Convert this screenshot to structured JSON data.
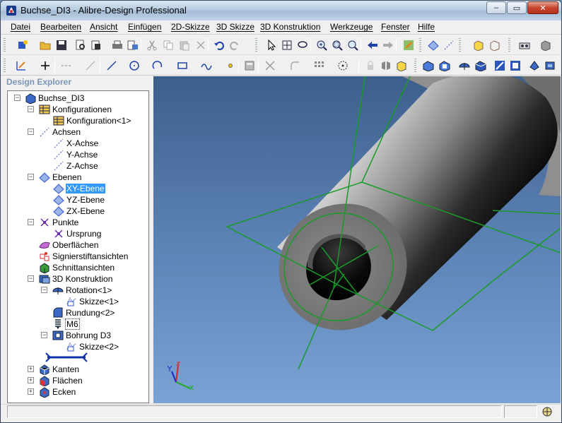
{
  "window": {
    "title": "Buchse_DI3 - Alibre-Design Professional",
    "minimize": "‒",
    "maximize": "▭",
    "close": "✕"
  },
  "menu": [
    "Datei",
    "Bearbeiten",
    "Ansicht",
    "Einfügen",
    "2D-Skizze",
    "3D Skizze",
    "3D Konstruktion",
    "Werkzeuge",
    "Fenster",
    "Hilfe"
  ],
  "explorer": {
    "header": "Design Explorer",
    "root": "Buchse_DI3",
    "konfigurationen": "Konfigurationen",
    "konfiguration1": "Konfiguration<1>",
    "achsen": "Achsen",
    "x_achse": "X-Achse",
    "y_achse": "Y-Achse",
    "z_achse": "Z-Achse",
    "ebenen": "Ebenen",
    "xy_ebene": "XY-Ebene",
    "yz_ebene": "YZ-Ebene",
    "zx_ebene": "ZX-Ebene",
    "punkte": "Punkte",
    "ursprung": "Ursprung",
    "oberflaechen": "Oberflächen",
    "signierstift": "Signierstiftansichten",
    "schnitt": "Schnittansichten",
    "konstruktion": "3D Konstruktion",
    "rotation": "Rotation<1>",
    "skizze1": "Skizze<1>",
    "rundung": "Rundung<2>",
    "m6": "M6",
    "bohrung": "Bohrung D3",
    "skizze2": "Skizze<2>",
    "kanten": "Kanten",
    "flaechen": "Flächen",
    "ecken": "Ecken"
  },
  "colors": {
    "selection": "#3399ff",
    "sketch_green": "#1a9a2a",
    "viewport_top": "#3d5f8c",
    "viewport_bottom": "#7aa2d4"
  },
  "icons": {
    "toolbar1": [
      "new-part-icon",
      "open-folder-icon",
      "save-icon",
      "print-preview-icon",
      "publish-icon",
      "print-icon",
      "export-icon",
      "cut-icon",
      "copy-icon",
      "paste-icon",
      "delete-icon",
      "undo-icon",
      "redo-icon",
      "select-arrow-icon",
      "move-icon",
      "lasso-icon",
      "zoom-in-icon",
      "zoom-window-icon",
      "zoom-fit-icon",
      "previous-view-icon",
      "next-view-icon",
      "insert-feature-icon",
      "plane-icon",
      "axis-icon",
      "iso-view-icon",
      "view-cube-icon",
      "assembly-icon",
      "shade-icon"
    ],
    "toolbar2": [
      "sketch-icon",
      "cross-icon",
      "dash-line-icon",
      "arrow-line-icon",
      "line-icon",
      "circle-icon",
      "arc-icon",
      "rectangle-icon",
      "spline-icon",
      "point-icon",
      "calculator-icon",
      "trim-icon",
      "fillet-icon",
      "pattern-icon",
      "snap-icon",
      "lock-icon",
      "mirror-icon",
      "offset-icon",
      "extrude-icon",
      "cut-extrude-icon",
      "revolve-icon",
      "boolean-icon",
      "sweep-icon",
      "loft-icon",
      "shell-icon",
      "draft-icon"
    ]
  }
}
